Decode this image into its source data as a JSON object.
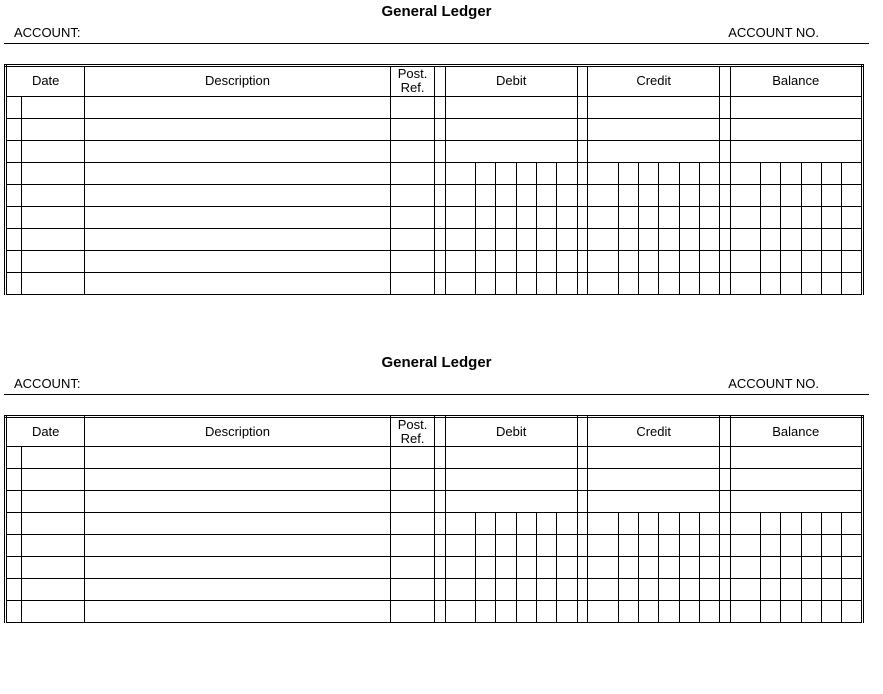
{
  "ledger1": {
    "title": "General Ledger",
    "account_label": "ACCOUNT:",
    "account_no_label": "ACCOUNT NO.",
    "columns": {
      "date": "Date",
      "description": "Description",
      "post_ref": "Post.\nRef.",
      "debit": "Debit",
      "credit": "Credit",
      "balance": "Balance"
    }
  },
  "ledger2": {
    "title": "General Ledger",
    "account_label": "ACCOUNT:",
    "account_no_label": "ACCOUNT NO.",
    "columns": {
      "date": "Date",
      "description": "Description",
      "post_ref": "Post.\nRef.",
      "debit": "Debit",
      "credit": "Credit",
      "balance": "Balance"
    }
  }
}
